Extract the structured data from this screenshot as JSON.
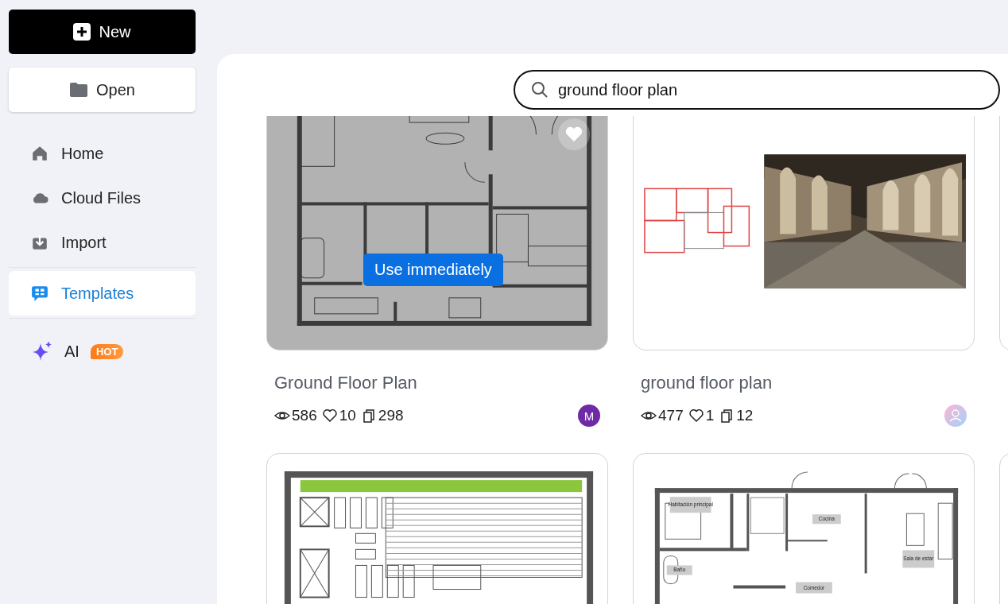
{
  "sidebar": {
    "new_button": "New",
    "open_button": "Open",
    "nav": [
      {
        "label": "Home",
        "kind": "home",
        "selected": false
      },
      {
        "label": "Cloud Files",
        "kind": "cloud",
        "selected": false
      },
      {
        "label": "Import",
        "kind": "import",
        "selected": false
      },
      {
        "label": "Templates",
        "kind": "templates",
        "selected": true
      }
    ],
    "ai": {
      "label": "AI",
      "badge": "HOT"
    }
  },
  "search": {
    "value": "ground floor plan"
  },
  "templates": [
    {
      "kind": "plan_a",
      "hovered": true,
      "hover_action": "Use immediately",
      "title": "Ground Floor Plan",
      "views": "586",
      "likes": "10",
      "copies": "298",
      "avatar": {
        "kind": "letter",
        "text": "M",
        "color": "#6f2aa6"
      }
    },
    {
      "kind": "plan_photo",
      "hovered": false,
      "title": "ground floor plan",
      "views": "477",
      "likes": "1",
      "copies": "12",
      "avatar": {
        "kind": "person"
      }
    },
    {
      "kind": "edge",
      "hovered": false
    },
    {
      "kind": "plan_grid",
      "hovered": false
    },
    {
      "kind": "plan_rooms",
      "hovered": false,
      "room_labels": [
        "Habitación principal",
        "Cocina",
        "Baño",
        "Sala de estar",
        "Comedor"
      ]
    },
    {
      "kind": "edge",
      "hovered": false
    }
  ]
}
